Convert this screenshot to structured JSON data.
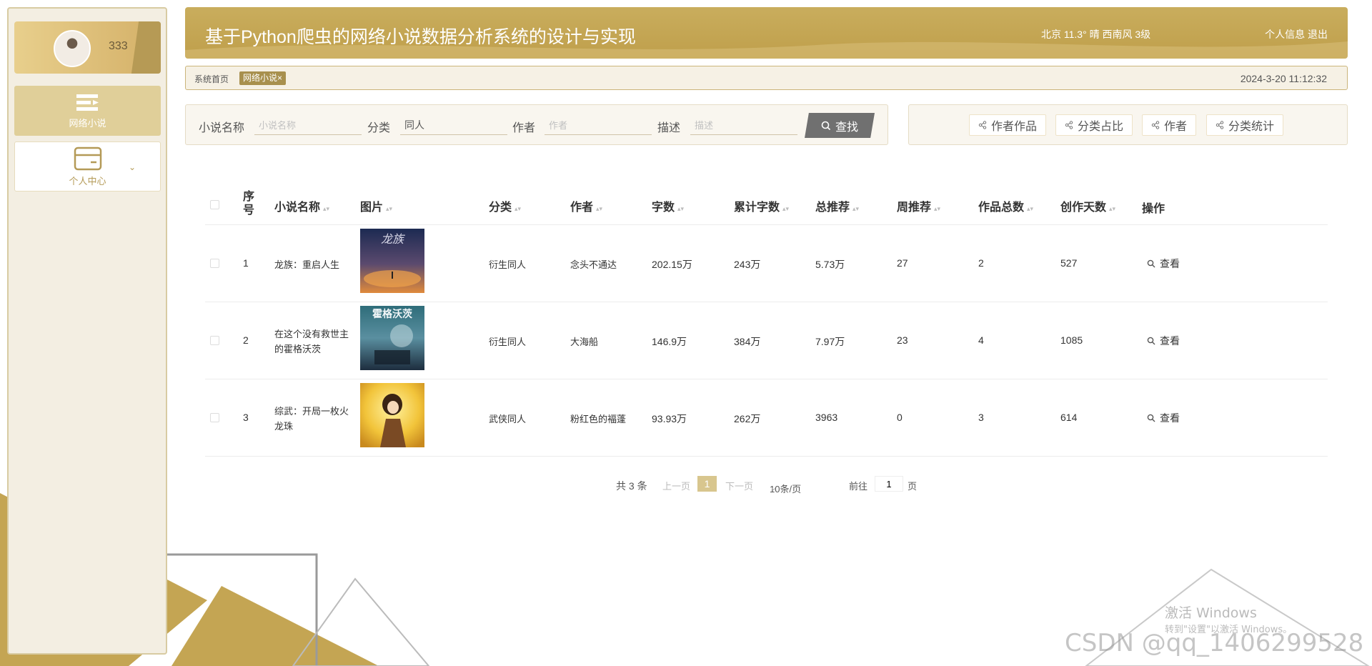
{
  "app": {
    "title": "基于Python爬虫的网络小说数据分析系统的设计与实现",
    "weather": "北京  11.3°  晴  西南风  3级",
    "user_links": "个人信息  退出"
  },
  "sidebar": {
    "username": "333",
    "items": [
      {
        "label": "网络小说"
      },
      {
        "label": "个人中心"
      }
    ]
  },
  "breadcrumb": {
    "home": "系统首页",
    "tag": "网络小说×",
    "datetime": "2024-3-20 11:12:32"
  },
  "search": {
    "name_label": "小说名称",
    "name_placeholder": "小说名称",
    "name_value": "",
    "category_label": "分类",
    "category_value": "同人",
    "author_label": "作者",
    "author_placeholder": "作者",
    "desc_label": "描述",
    "desc_placeholder": "描述",
    "button": "查找"
  },
  "actions": [
    "作者作品",
    "分类占比",
    "作者",
    "分类统计"
  ],
  "table": {
    "headers": [
      "序号",
      "小说名称",
      "图片",
      "分类",
      "作者",
      "字数",
      "累计字数",
      "总推荐",
      "周推荐",
      "作品总数",
      "创作天数",
      "操作"
    ],
    "rows": [
      {
        "index": "1",
        "name": "龙族：重启人生",
        "category": "衍生同人",
        "author": "念头不通达",
        "words": "202.15万",
        "total_words": "243万",
        "total_rec": "5.73万",
        "week_rec": "27",
        "works": "2",
        "days": "527",
        "action": "查看",
        "cover_text": "龙族"
      },
      {
        "index": "2",
        "name": "在这个没有救世主的霍格沃茨",
        "category": "衍生同人",
        "author": "大海船",
        "words": "146.9万",
        "total_words": "384万",
        "total_rec": "7.97万",
        "week_rec": "23",
        "works": "4",
        "days": "1085",
        "action": "查看",
        "cover_text": "霍格沃茨"
      },
      {
        "index": "3",
        "name": "综武：开局一枚火龙珠",
        "category": "武侠同人",
        "author": "粉红色的褔蓬",
        "words": "93.93万",
        "total_words": "262万",
        "total_rec": "3963",
        "week_rec": "0",
        "works": "3",
        "days": "614",
        "action": "查看",
        "cover_text": ""
      }
    ]
  },
  "pagination": {
    "total": "共 3 条",
    "prev": "上一页",
    "current": "1",
    "next": "下一页",
    "page_size": "10条/页",
    "goto_label": "前往",
    "goto_value": "1",
    "page_suffix": "页"
  },
  "watermark": {
    "activate_title": "激活 Windows",
    "activate_sub": "转到\"设置\"以激活 Windows。",
    "csdn": "CSDN @qq_1406299528"
  },
  "colors": {
    "accent": "#c4a553",
    "sidebar_bg": "#f3eee2",
    "active_menu": "#e0cf99"
  }
}
